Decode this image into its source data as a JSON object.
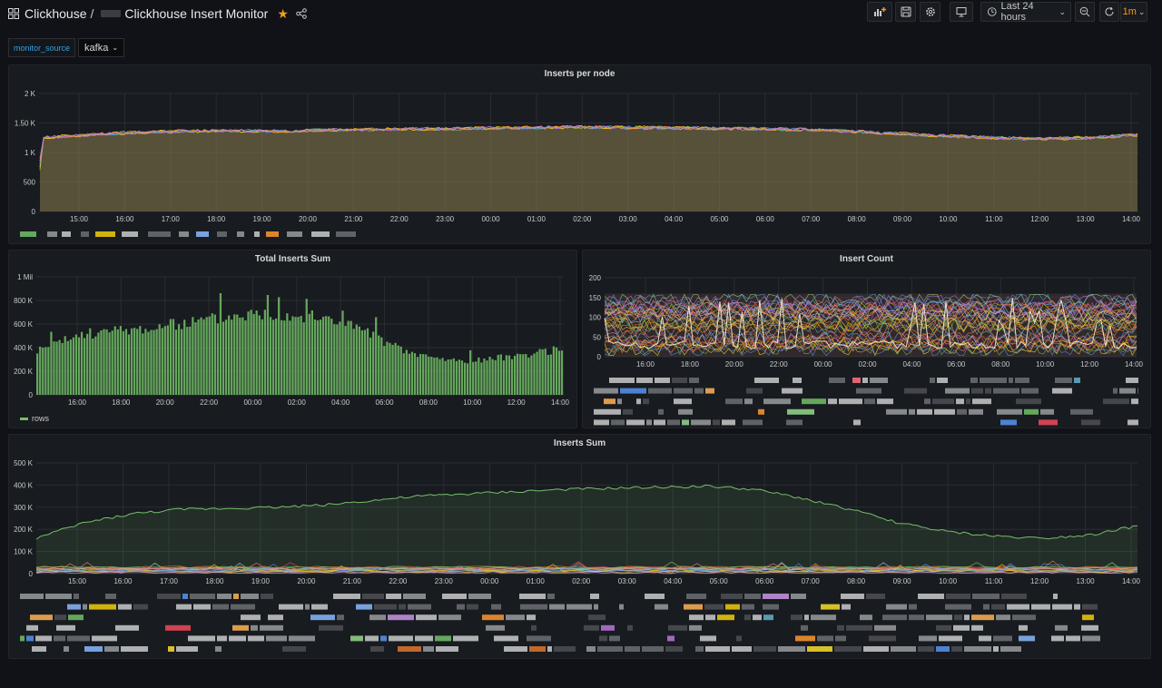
{
  "breadcrumb": {
    "folder": "Clickhouse",
    "separator": "/",
    "title": "Clickhouse Insert Monitor"
  },
  "toolbar": {
    "time_range": "Last 24 hours",
    "refresh_interval": "1m"
  },
  "variables": {
    "label": "monitor_source",
    "value": "kafka"
  },
  "colors": {
    "accent": "#f29c1f",
    "green": "#73bf69",
    "yellow": "#f2cc0c",
    "blue": "#5794f2",
    "orange": "#ff9830"
  },
  "panels": {
    "inserts_per_node": {
      "title": "Inserts per node"
    },
    "total_inserts_sum": {
      "title": "Total Inserts Sum",
      "legend": "rows"
    },
    "insert_count": {
      "title": "Insert Count"
    },
    "inserts_sum": {
      "title": "Inserts Sum"
    }
  },
  "chart_data": [
    {
      "id": "inserts_per_node",
      "type": "area",
      "title": "Inserts per node",
      "yticks": [
        "0",
        "500",
        "1 K",
        "1.50 K",
        "2 K"
      ],
      "ylim": [
        0,
        2000
      ],
      "xticks": [
        "15:00",
        "16:00",
        "17:00",
        "18:00",
        "19:00",
        "20:00",
        "21:00",
        "22:00",
        "23:00",
        "00:00",
        "01:00",
        "02:00",
        "03:00",
        "04:00",
        "05:00",
        "06:00",
        "07:00",
        "08:00",
        "09:00",
        "10:00",
        "11:00",
        "12:00",
        "13:00",
        "14:00"
      ],
      "grid": true,
      "series_profile": [
        1250,
        1300,
        1340,
        1360,
        1370,
        1360,
        1380,
        1390,
        1400,
        1410,
        1420,
        1430,
        1430,
        1420,
        1410,
        1400,
        1390,
        1360,
        1320,
        1280,
        1250,
        1230,
        1250,
        1300
      ]
    },
    {
      "id": "total_inserts_sum",
      "type": "bar",
      "title": "Total Inserts Sum",
      "yticks": [
        "0",
        "200 K",
        "400 K",
        "600 K",
        "800 K",
        "1 Mil"
      ],
      "ylim": [
        0,
        1000000
      ],
      "xticks": [
        "16:00",
        "18:00",
        "20:00",
        "22:00",
        "00:00",
        "02:00",
        "04:00",
        "06:00",
        "08:00",
        "10:00",
        "12:00",
        "14:00"
      ],
      "grid": true,
      "legend": "rows",
      "values_profile": [
        380000,
        450000,
        520000,
        540000,
        560000,
        570000,
        600000,
        630000,
        660000,
        690000,
        700000,
        690000,
        670000,
        640000,
        580000,
        480000,
        380000,
        330000,
        300000,
        290000,
        310000,
        340000,
        360000,
        400000
      ]
    },
    {
      "id": "insert_count",
      "type": "line",
      "title": "Insert Count",
      "yticks": [
        "0",
        "50",
        "100",
        "150",
        "200"
      ],
      "ylim": [
        0,
        200
      ],
      "xticks": [
        "16:00",
        "18:00",
        "20:00",
        "22:00",
        "00:00",
        "02:00",
        "04:00",
        "06:00",
        "08:00",
        "10:00",
        "12:00",
        "14:00"
      ],
      "grid": true
    },
    {
      "id": "inserts_sum",
      "type": "area",
      "title": "Inserts Sum",
      "yticks": [
        "0",
        "100 K",
        "200 K",
        "300 K",
        "400 K",
        "500 K"
      ],
      "ylim": [
        0,
        500000
      ],
      "xticks": [
        "15:00",
        "16:00",
        "17:00",
        "18:00",
        "19:00",
        "20:00",
        "21:00",
        "22:00",
        "23:00",
        "00:00",
        "01:00",
        "02:00",
        "03:00",
        "04:00",
        "05:00",
        "06:00",
        "07:00",
        "08:00",
        "09:00",
        "10:00",
        "11:00",
        "12:00",
        "13:00",
        "14:00"
      ],
      "grid": true,
      "main_series_profile": [
        160000,
        230000,
        270000,
        290000,
        295000,
        300000,
        310000,
        330000,
        350000,
        360000,
        370000,
        380000,
        385000,
        390000,
        395000,
        380000,
        340000,
        290000,
        230000,
        190000,
        170000,
        160000,
        175000,
        215000
      ]
    }
  ]
}
